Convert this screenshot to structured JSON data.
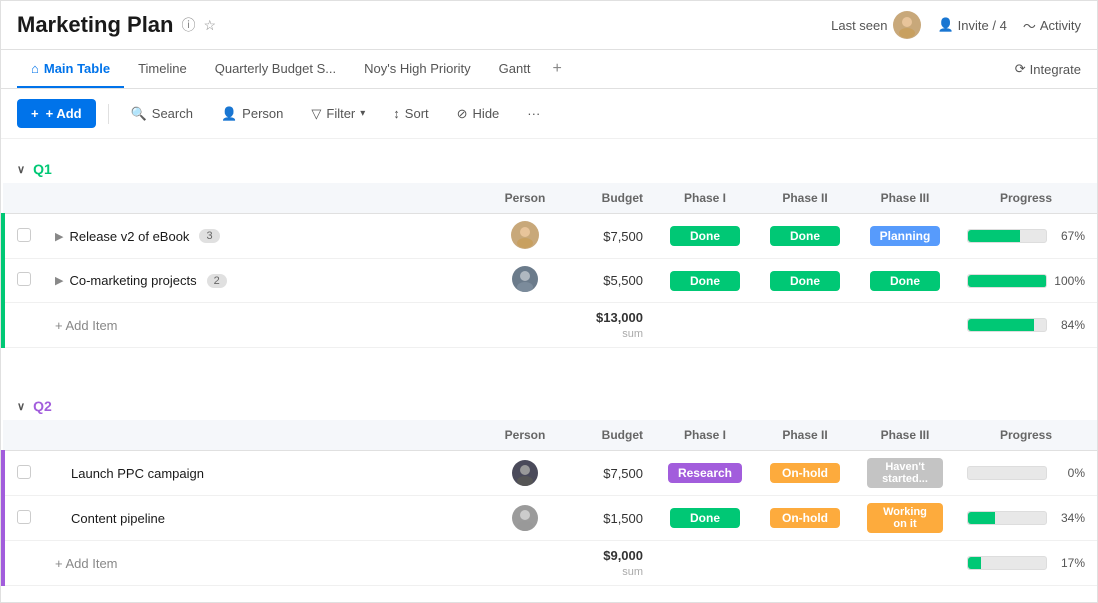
{
  "app": {
    "title": "Marketing Plan",
    "last_seen_label": "Last seen",
    "invite_label": "Invite / 4",
    "activity_label": "Activity"
  },
  "tabs": {
    "items": [
      {
        "label": "Main Table",
        "icon": "home",
        "active": true
      },
      {
        "label": "Timeline",
        "active": false
      },
      {
        "label": "Quarterly Budget S...",
        "active": false
      },
      {
        "label": "Noy's High Priority",
        "active": false
      },
      {
        "label": "Gantt",
        "active": false
      }
    ],
    "add_label": "+",
    "integrate_label": "Integrate"
  },
  "toolbar": {
    "add_label": "+ Add",
    "search_label": "Search",
    "person_label": "Person",
    "filter_label": "Filter",
    "sort_label": "Sort",
    "hide_label": "Hide",
    "more_label": "···"
  },
  "groups": [
    {
      "id": "q1",
      "label": "Q1",
      "color": "#00c875",
      "columns": {
        "person": "Person",
        "budget": "Budget",
        "phase1": "Phase I",
        "phase2": "Phase II",
        "phase3": "Phase III",
        "progress": "Progress"
      },
      "rows": [
        {
          "name": "Release v2 of eBook",
          "count": 3,
          "person_color": "#c8a87a",
          "person_initials": "",
          "budget": "$7,500",
          "phase1": {
            "label": "Done",
            "class": "phase-done"
          },
          "phase2": {
            "label": "Done",
            "class": "phase-done"
          },
          "phase3": {
            "label": "Planning",
            "class": "phase-planning"
          },
          "progress": 67,
          "progress_label": "67%"
        },
        {
          "name": "Co-marketing projects",
          "count": 2,
          "person_color": "#7b7b9b",
          "person_initials": "",
          "budget": "$5,500",
          "phase1": {
            "label": "Done",
            "class": "phase-done"
          },
          "phase2": {
            "label": "Done",
            "class": "phase-done"
          },
          "phase3": {
            "label": "Done",
            "class": "phase-done"
          },
          "progress": 100,
          "progress_label": "100%"
        }
      ],
      "sum": {
        "budget": "$13,000",
        "label": "sum",
        "progress": 84,
        "progress_label": "84%"
      }
    },
    {
      "id": "q2",
      "label": "Q2",
      "color": "#a25ddc",
      "columns": {
        "person": "Person",
        "budget": "Budget",
        "phase1": "Phase I",
        "phase2": "Phase II",
        "phase3": "Phase III",
        "progress": "Progress"
      },
      "rows": [
        {
          "name": "Launch PPC campaign",
          "count": null,
          "person_color": "#4a4a5a",
          "person_initials": "",
          "budget": "$7,500",
          "phase1": {
            "label": "Research",
            "class": "phase-research"
          },
          "phase2": {
            "label": "On-hold",
            "class": "phase-onhold"
          },
          "phase3": {
            "label": "Haven't started...",
            "class": "phase-haventstarted"
          },
          "progress": 0,
          "progress_label": "0%"
        },
        {
          "name": "Content pipeline",
          "count": null,
          "person_color": "#9b9b9b",
          "person_initials": "",
          "budget": "$1,500",
          "phase1": {
            "label": "Done",
            "class": "phase-done"
          },
          "phase2": {
            "label": "On-hold",
            "class": "phase-onhold"
          },
          "phase3": {
            "label": "Working on it",
            "class": "phase-workingonit"
          },
          "progress": 34,
          "progress_label": "34%"
        }
      ],
      "sum": {
        "budget": "$9,000",
        "label": "sum",
        "progress": 17,
        "progress_label": "17%"
      }
    }
  ]
}
